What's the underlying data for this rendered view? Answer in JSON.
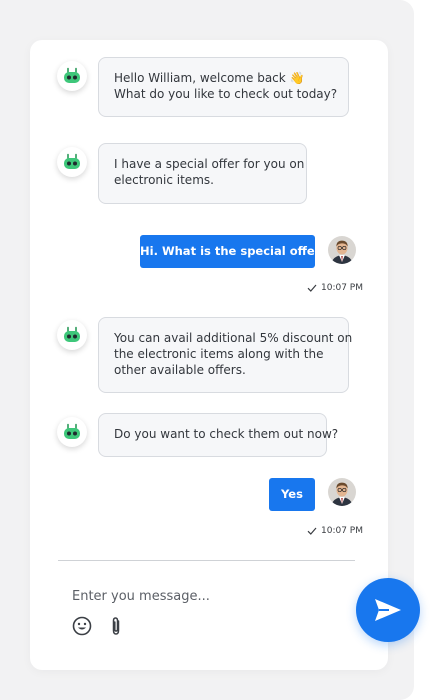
{
  "colors": {
    "accent": "#1877ee",
    "bot_green": "#3ec77a",
    "bubble_bg": "#f6f7f9",
    "bubble_border": "#d8dbe0"
  },
  "messages": [
    {
      "from": "bot",
      "lines": [
        "Hello William, welcome back 👋",
        "What do you like to check out today?"
      ]
    },
    {
      "from": "bot",
      "lines": [
        "I have a special offer for you on",
        "electronic items."
      ]
    },
    {
      "from": "user",
      "text": "Hi. What is the special offer?",
      "time": "10:07 PM",
      "status_icon": "check-icon"
    },
    {
      "from": "bot",
      "lines": [
        "You can avail additional 5% discount on",
        "the electronic items along with the",
        "other available offers."
      ]
    },
    {
      "from": "bot",
      "lines": [
        "Do you want to check them out now?"
      ]
    },
    {
      "from": "user",
      "text": "Yes",
      "time": "10:07 PM",
      "status_icon": "check-icon"
    }
  ],
  "composer": {
    "placeholder": "Enter you message...",
    "emoji_icon": "smiley-icon",
    "attach_icon": "paperclip-icon",
    "send_icon": "paper-plane-icon"
  }
}
